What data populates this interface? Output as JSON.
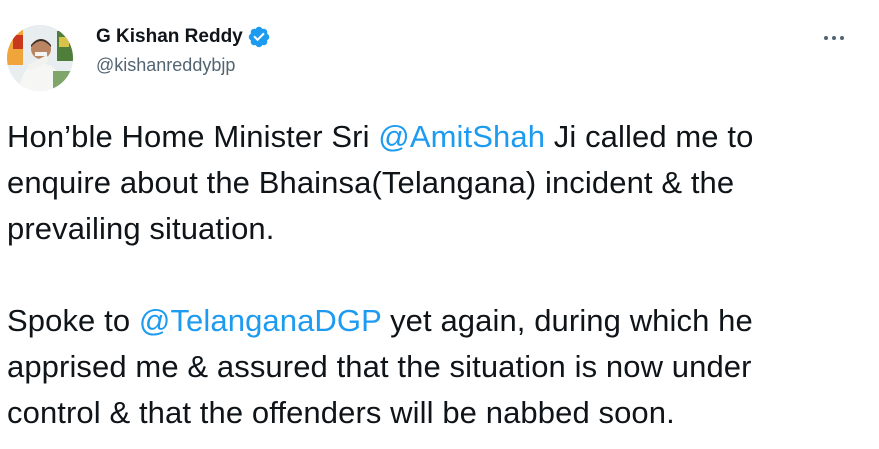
{
  "author": {
    "display_name": "G Kishan Reddy",
    "handle": "@kishanreddybjp",
    "verified": true
  },
  "colors": {
    "accent": "#1d9bf0",
    "text": "#0f1419",
    "secondary": "#536471"
  },
  "icons": {
    "verified": "verified-badge-icon",
    "more": "more-horizontal-icon"
  },
  "tweet": {
    "p1": {
      "l1_a": "Hon’ble Home Minister Sri ",
      "l1_mention": "@AmitShah",
      "l1_b": " Ji called me to",
      "l2": "enquire about the Bhainsa(Telangana) incident & the",
      "l3": "prevailing situation."
    },
    "p2": {
      "l1_a": "Spoke to ",
      "l1_mention": "@TelanganaDGP",
      "l1_b": " yet again, during which he",
      "l2": "apprised me & assured that the situation is now under",
      "l3": "control & that the offenders will be nabbed soon."
    }
  }
}
